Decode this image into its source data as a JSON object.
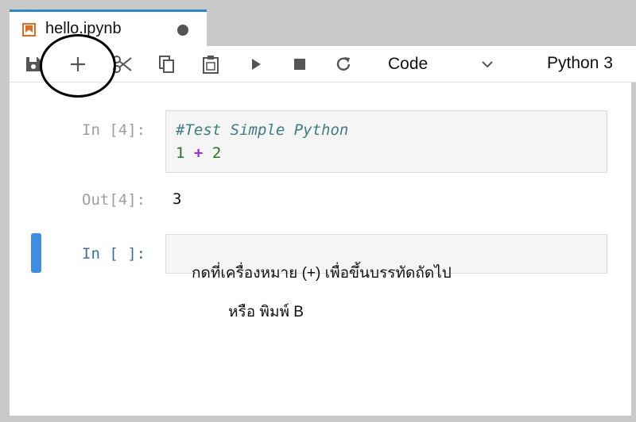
{
  "tab": {
    "title": "hello.ipynb"
  },
  "toolbar": {
    "cell_type": "Code",
    "kernel": "Python 3",
    "buttons": [
      {
        "name": "save-icon"
      },
      {
        "name": "add-cell-icon"
      },
      {
        "name": "cut-icon"
      },
      {
        "name": "copy-icon"
      },
      {
        "name": "paste-icon"
      },
      {
        "name": "run-icon"
      },
      {
        "name": "stop-icon"
      },
      {
        "name": "restart-icon"
      }
    ]
  },
  "cells": [
    {
      "prompt": "In [4]:",
      "code_comment": "#Test Simple Python",
      "code_left": "1",
      "code_op": "+",
      "code_right": "2",
      "output_prompt": "Out[4]:",
      "output": "3"
    },
    {
      "prompt": "In [ ]:"
    }
  ],
  "annotation": {
    "line1": "กดที่เครื่องหมาย (+) เพื่อขึ้นบรรทัดถัดไป",
    "line2": "หรือ พิมพ์  B"
  },
  "colors": {
    "accent": "#2f86d0",
    "active_cell_bar": "#3d8ee0",
    "notebook_icon": "#e06c1f"
  }
}
